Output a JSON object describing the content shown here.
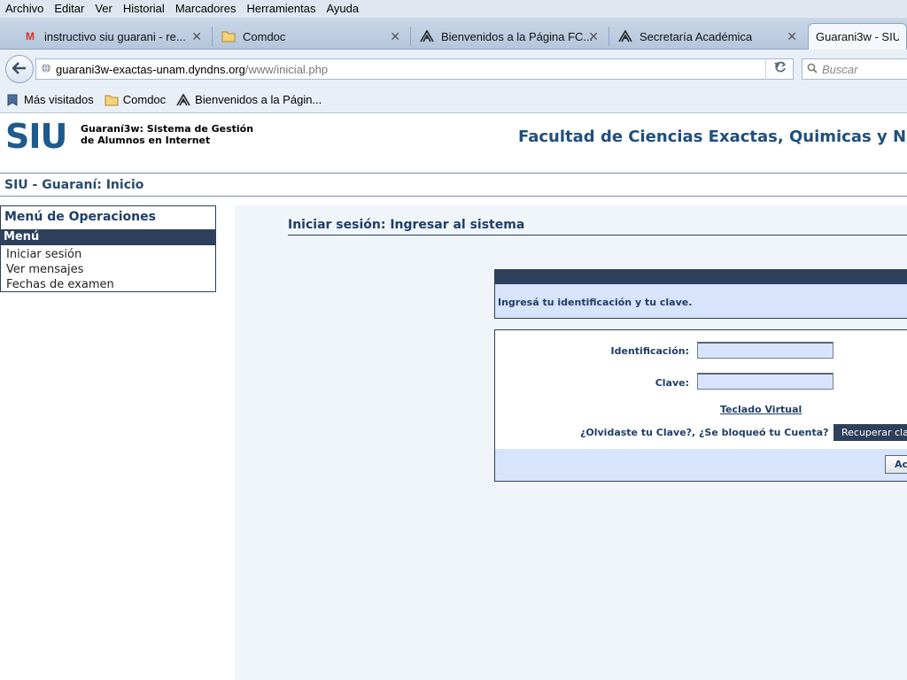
{
  "menubar": {
    "items": [
      "Archivo",
      "Editar",
      "Ver",
      "Historial",
      "Marcadores",
      "Herramientas",
      "Ayuda"
    ]
  },
  "tabs": [
    {
      "title": "instructivo siu guarani - re...",
      "icon": "gmail-icon"
    },
    {
      "title": "Comdoc",
      "icon": "folder-icon"
    },
    {
      "title": "Bienvenidos a la Página FC...",
      "icon": "unam-logo-icon"
    },
    {
      "title": "Secretaría Académica",
      "icon": "unam-logo-icon"
    },
    {
      "title": "Guarani3w - SIU - ",
      "icon": "",
      "active": true
    }
  ],
  "navbar": {
    "url_host": "guarani3w-exactas-unam.dyndns.org",
    "url_path": "/www/inicial.php",
    "search_placeholder": "Buscar"
  },
  "bookmarks": [
    {
      "label": "Más visitados",
      "icon": "bookmark-icon"
    },
    {
      "label": "Comdoc",
      "icon": "folder-icon"
    },
    {
      "label": "Bienvenidos a la Págin...",
      "icon": "unam-logo-icon"
    }
  ],
  "header": {
    "logo": "SIU",
    "system_line1": "Guaraní3w: Sistema de Gestión",
    "system_line2": "de Alumnos en Internet",
    "faculty": "Facultad de Ciencias Exactas, Quimicas y Natura"
  },
  "page_title": "SIU - Guaraní: Inicio",
  "menu": {
    "heading": "Menú de Operaciones",
    "band": "Menú",
    "items": [
      "Iniciar sesión",
      "Ver mensajes",
      "Fechas de examen"
    ]
  },
  "login": {
    "title": "Iniciar sesión: Ingresar al sistema",
    "message": "Ingresá tu identificación y tu clave.",
    "id_label": "Identificación:",
    "pass_label": "Clave:",
    "keyboard_link": "Teclado Virtual",
    "forgot_text": "¿Olvidaste tu Clave?, ¿Se bloqueó tu Cuenta?",
    "recover_button": "Recuperar cla",
    "accept_button": "Ac"
  },
  "colors": {
    "accent_dark": "#2e405b",
    "text_blue": "#1f3e66",
    "field_bg": "#d8e4fb",
    "logo_blue": "#1f5a8e"
  }
}
